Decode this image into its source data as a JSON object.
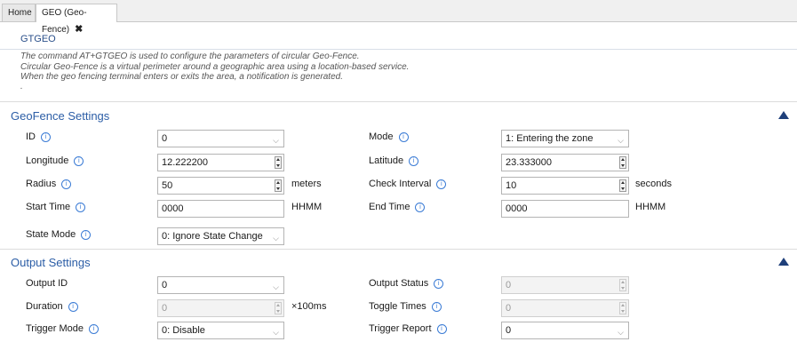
{
  "tabs": {
    "home": "Home",
    "active": "GEO (Geo-Fence)",
    "close": "✖"
  },
  "header": {
    "title": "GTGEO",
    "desc1": "The command AT+GTGEO is used to configure the parameters of circular Geo-Fence.",
    "desc2": "Circular Geo-Fence is a virtual perimeter around a geographic area using a location-based service.",
    "desc3": "When the geo fencing terminal enters or exits the area, a notification is generated.",
    "desc4": "."
  },
  "info_glyph": "i",
  "chevron": "⌵",
  "geofence": {
    "title": "GeoFence Settings",
    "id": {
      "label": "ID",
      "value": "0"
    },
    "mode": {
      "label": "Mode",
      "value": "1: Entering the zone"
    },
    "longitude": {
      "label": "Longitude",
      "value": "12.222200"
    },
    "latitude": {
      "label": "Latitude",
      "value": "23.333000"
    },
    "radius": {
      "label": "Radius",
      "value": "50",
      "unit": "meters"
    },
    "check_interval": {
      "label": "Check Interval",
      "value": "10",
      "unit": "seconds"
    },
    "start_time": {
      "label": "Start Time",
      "value": "0000",
      "unit": "HHMM"
    },
    "end_time": {
      "label": "End Time",
      "value": "0000",
      "unit": "HHMM"
    },
    "state_mode": {
      "label": "State Mode",
      "value": "0: Ignore State Change"
    }
  },
  "output": {
    "title": "Output Settings",
    "output_id": {
      "label": "Output ID",
      "value": "0"
    },
    "output_status": {
      "label": "Output Status",
      "value": "0"
    },
    "duration": {
      "label": "Duration",
      "value": "0",
      "unit": "×100ms"
    },
    "toggle_times": {
      "label": "Toggle Times",
      "value": "0"
    },
    "trigger_mode": {
      "label": "Trigger Mode",
      "value": "0: Disable"
    },
    "trigger_report": {
      "label": "Trigger Report",
      "value": "0"
    }
  },
  "colors": {
    "accent": "#2b5da6",
    "collapse_arrow": "#1e3f7a",
    "info_icon": "#3a7bd5"
  }
}
